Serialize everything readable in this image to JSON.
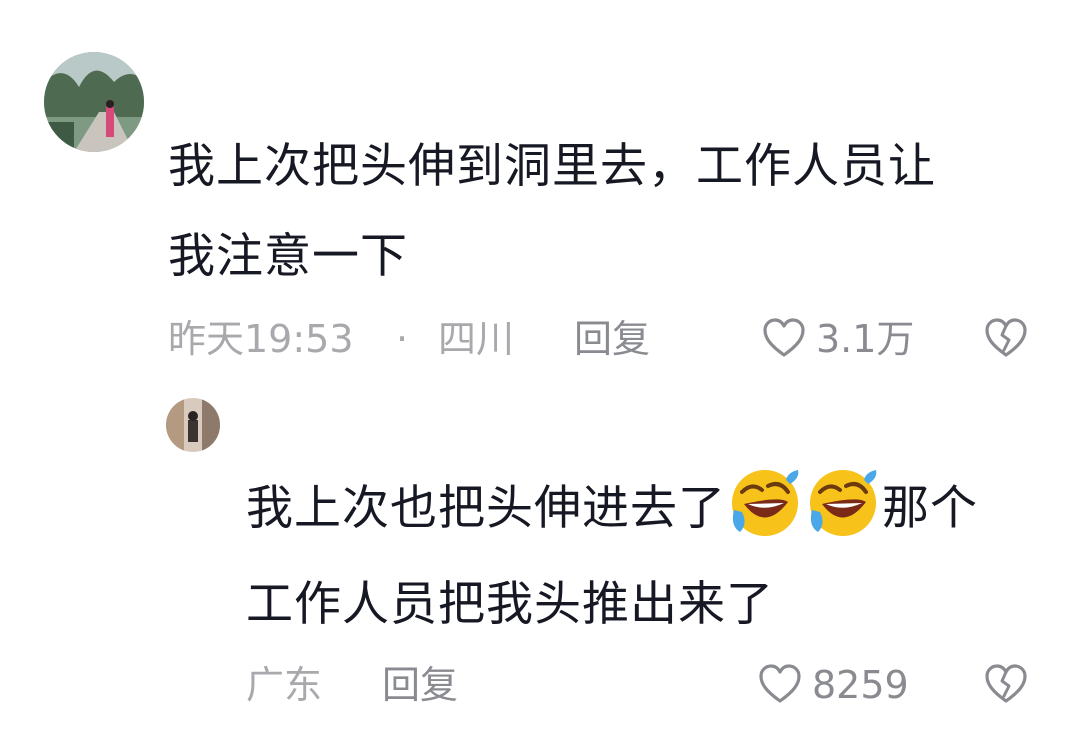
{
  "comments": [
    {
      "text_line1": "我上次把头伸到洞里去，工作人员让",
      "text_line2": "我注意一下",
      "time": "昨天19:53",
      "dot": "·",
      "location": "四川",
      "reply_label": "回复",
      "likes": "3.1万"
    },
    {
      "text_line1_a": "我上次也把头伸进去了",
      "text_line1_b": "那个",
      "text_line2": "工作人员把我头推出来了",
      "location": "广东",
      "reply_label": "回复",
      "likes": "8259",
      "emoji_name": "rolling-on-floor-laughing-emoji"
    }
  ],
  "colors": {
    "text": "#161823",
    "meta": "#a9a9ad",
    "action": "#8a8b91",
    "emoji_face": "#f7c21a"
  },
  "icons": [
    "heart-outline-icon",
    "broken-heart-icon"
  ]
}
